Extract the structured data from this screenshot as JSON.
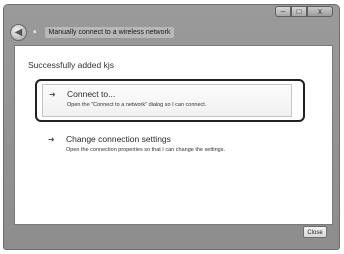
{
  "window": {
    "title": "Manually connect to a wireless network",
    "controls": {
      "minimize": "–",
      "maximize": "□",
      "close": "x"
    }
  },
  "nav": {
    "back_symbol": "◀",
    "network_symbol": "▪"
  },
  "content": {
    "heading": "Successfully added kjs",
    "options": [
      {
        "title": "Connect to...",
        "description": "Open the \"Connect to a network\" dialog so I can connect.",
        "arrow": "➜"
      },
      {
        "title": "Change connection settings",
        "description": "Open the connection properties so that I can change the settings.",
        "arrow": "➜"
      }
    ]
  },
  "footer": {
    "close_label": "Close"
  }
}
